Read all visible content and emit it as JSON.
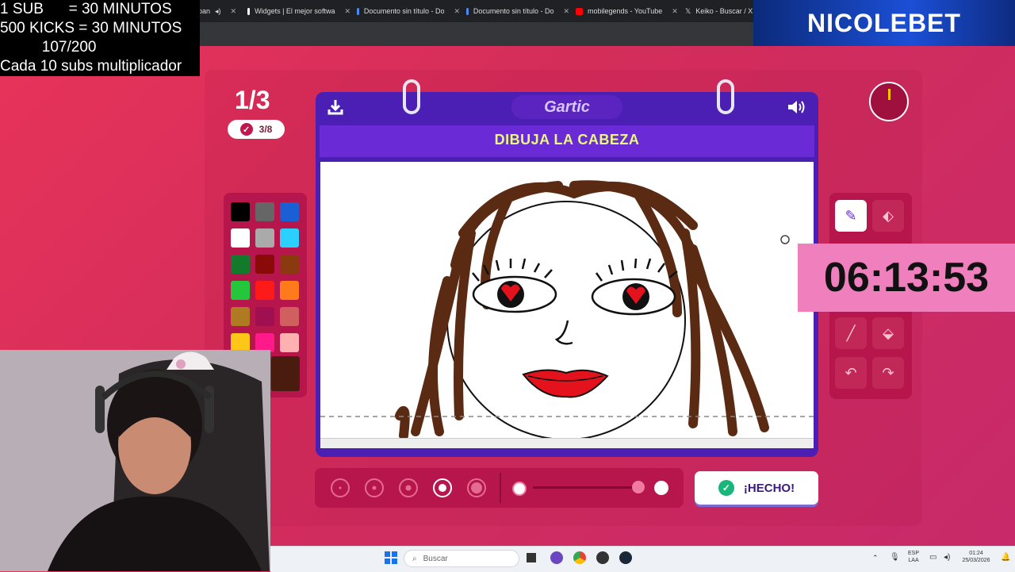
{
  "stream_overlay": {
    "lines": [
      "1 SUB      = 30 MINUTOS",
      "500 KICKS = 30 MINUTOS",
      "          107/200",
      "Cada 10 subs multiplicador"
    ],
    "brand": "NICOLEBET",
    "countdown": "06:13:53"
  },
  "browser_tabs": [
    {
      "title": "Widgets | El mejor softwa",
      "color": "#ffffff"
    },
    {
      "title": "Documento sin título - Do",
      "color": "#4a8af4"
    },
    {
      "title": "Documento sin título - Do",
      "color": "#4a8af4"
    },
    {
      "title": "mobilegends - YouTube",
      "color": "#ff0000"
    },
    {
      "title": "Keiko - Buscar / X",
      "color": "#ffffff"
    }
  ],
  "game": {
    "round": "1/3",
    "guessed": "3/8",
    "logo": "Gartic",
    "prompt": "DIBUJA LA CABEZA",
    "done_label": "¡HECHO!",
    "icons": {
      "download": "download-icon",
      "sound": "speaker-icon",
      "timer": "timer-icon"
    },
    "palette": [
      "#000000",
      "#666666",
      "#1a5fd4",
      "#ffffff",
      "#aaaaaa",
      "#2ad0ff",
      "#127a2a",
      "#8a0a0a",
      "#8b3a10",
      "#24c63c",
      "#ff1a1a",
      "#ff7a1a",
      "#b07a22",
      "#a01050",
      "#d06060",
      "#ffc61a",
      "#ff1a8a",
      "#ffb0b0"
    ],
    "selected_color": "#4a1c10",
    "tools": [
      "pencil-icon",
      "eraser-icon",
      "",
      "",
      "line-icon",
      "fill-icon",
      "undo-icon",
      "redo-icon"
    ],
    "stroke_sizes": [
      "xs",
      "s",
      "m",
      "l",
      "xl"
    ],
    "selected_stroke": "l"
  },
  "taskbar": {
    "search_placeholder": "Buscar",
    "lang": "ESP",
    "lang2": "LAA",
    "time": "01:24",
    "date": "25/03/2026"
  }
}
